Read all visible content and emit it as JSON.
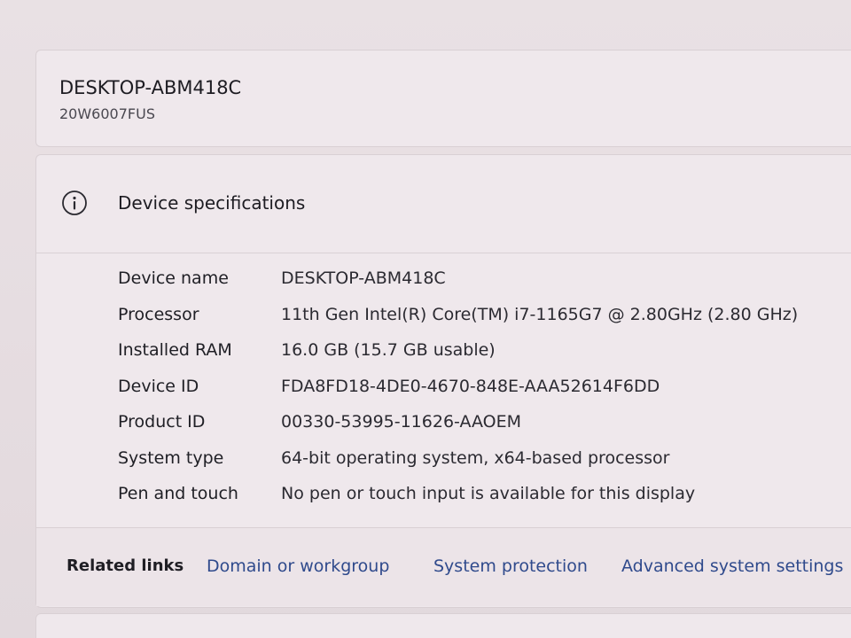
{
  "device": {
    "name": "DESKTOP-ABM418C",
    "model": "20W6007FUS"
  },
  "specs": {
    "title": "Device specifications",
    "icon": "info-icon",
    "rows": [
      {
        "label": "Device name",
        "value": "DESKTOP-ABM418C"
      },
      {
        "label": "Processor",
        "value": "11th Gen Intel(R) Core(TM) i7-1165G7 @ 2.80GHz (2.80 GHz)"
      },
      {
        "label": "Installed RAM",
        "value": "16.0 GB (15.7 GB usable)"
      },
      {
        "label": "Device ID",
        "value": "FDA8FD18-4DE0-4670-848E-AAA52614F6DD"
      },
      {
        "label": "Product ID",
        "value": "00330-53995-11626-AAOEM"
      },
      {
        "label": "System type",
        "value": "64-bit operating system, x64-based processor"
      },
      {
        "label": "Pen and touch",
        "value": "No pen or touch input is available for this display"
      }
    ]
  },
  "related": {
    "label": "Related links",
    "links": [
      {
        "label": "Domain or workgroup"
      },
      {
        "label": "System protection"
      },
      {
        "label": "Advanced system settings"
      }
    ]
  },
  "colors": {
    "link": "#2f4a8c",
    "background": "#ebe3e6",
    "card": "#efe8ec"
  }
}
